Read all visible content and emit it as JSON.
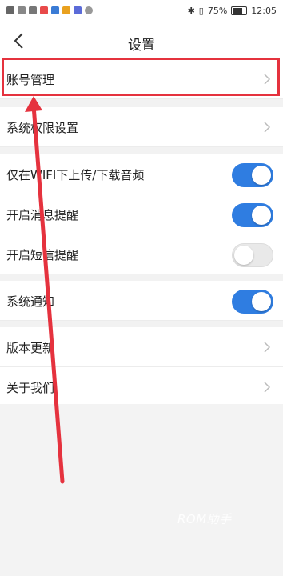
{
  "status_bar": {
    "battery": "75%",
    "time": "12:05",
    "battery_level": 0.75
  },
  "header": {
    "title": "设置"
  },
  "settings": {
    "account": "账号管理",
    "permissions": "系统权限设置",
    "wifi_audio": "仅在WIFI下上传/下载音频",
    "message_alerts": "开启消息提醒",
    "sms_alerts": "开启短信提醒",
    "system_notify": "系统通知",
    "version_update": "版本更新",
    "about_us": "关于我们"
  },
  "toggles": {
    "wifi_audio": true,
    "message_alerts": true,
    "sms_alerts": false,
    "system_notify": true
  },
  "colors": {
    "accent": "#2f7de1",
    "highlight": "#e5323e"
  },
  "watermark": "ROM助手"
}
